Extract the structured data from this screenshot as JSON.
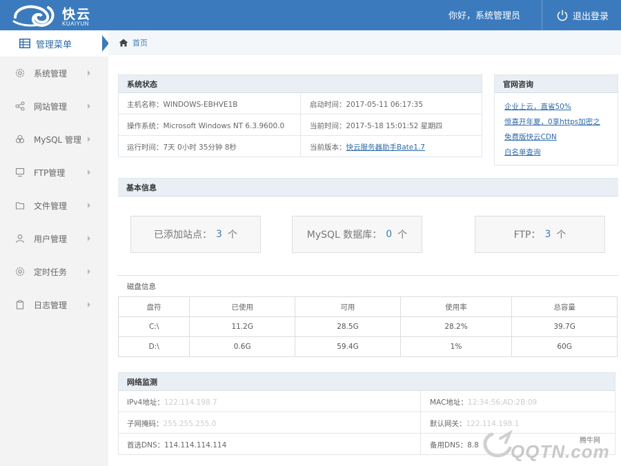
{
  "header": {
    "logo_text": "快云",
    "logo_sub": "KUAIYUN",
    "greeting": "你好，系统管理员",
    "logout_label": "退出登录"
  },
  "sidebar": {
    "title": "管理菜单",
    "items": [
      {
        "label": "系统管理",
        "icon": "gear-icon"
      },
      {
        "label": "网站管理",
        "icon": "share-icon"
      },
      {
        "label": "MySQL 管理",
        "icon": "database-icon"
      },
      {
        "label": "FTP管理",
        "icon": "monitor-icon"
      },
      {
        "label": "文件管理",
        "icon": "folder-icon"
      },
      {
        "label": "用户管理",
        "icon": "user-icon"
      },
      {
        "label": "定时任务",
        "icon": "clock-gear-icon"
      },
      {
        "label": "日志管理",
        "icon": "clipboard-icon"
      }
    ]
  },
  "breadcrumb": {
    "home": "首页"
  },
  "system_status": {
    "title": "系统状态",
    "hostname_label": "主机名称：",
    "hostname": "WINDOWS-EBHVE1B",
    "boot_label": "启动时间：",
    "boot_time": "2017-05-11 06:17:35",
    "os_label": "操作系统：",
    "os": "Microsoft Windows NT 6.3.9600.0",
    "now_label": "当前时间：",
    "now": "2017-5-18 15:01:52 星期四",
    "uptime_label": "运行时间：",
    "uptime": "7天 0小时 35分钟 8秒",
    "version_label": "当前版本：",
    "version": "快云服务器助手Bate1.7"
  },
  "official": {
    "title": "官网咨询",
    "links": [
      "企业上云，直省50%",
      "惊喜开年夏，0享https加密之",
      "免费版快云CDN",
      "白名单查询"
    ]
  },
  "basic_info": {
    "title": "基本信息",
    "sites_label": "已添加站点：",
    "sites_count": "3",
    "mysql_label": "MySQL 数据库：",
    "mysql_count": "0",
    "ftp_label": "FTP：",
    "ftp_count": "3",
    "unit": "个"
  },
  "disk_info": {
    "title": "磁盘信息",
    "columns": [
      "盘符",
      "已使用",
      "可用",
      "使用率",
      "总容量"
    ],
    "rows": [
      [
        "C:\\",
        "11.2G",
        "28.5G",
        "28.2%",
        "39.7G"
      ],
      [
        "D:\\",
        "0.6G",
        "59.4G",
        "1%",
        "60G"
      ]
    ]
  },
  "network": {
    "title": "网络监测",
    "ipv4_label": "IPv4地址：",
    "ipv4": "122.114.198.7",
    "mac_label": "MAC地址：",
    "mac": "12:34:56:AD:2B:09",
    "mask_label": "子网掩码：",
    "mask": "255.255.255.0",
    "gateway_label": "默认网关：",
    "gateway": "122.114.198.1",
    "dns1_label": "首选DNS：",
    "dns1": "114.114.114.114",
    "dns2_label": "备用DNS：",
    "dns2": "8.8"
  },
  "watermark": {
    "top": "腾牛网",
    "big": "QQTN.com"
  }
}
